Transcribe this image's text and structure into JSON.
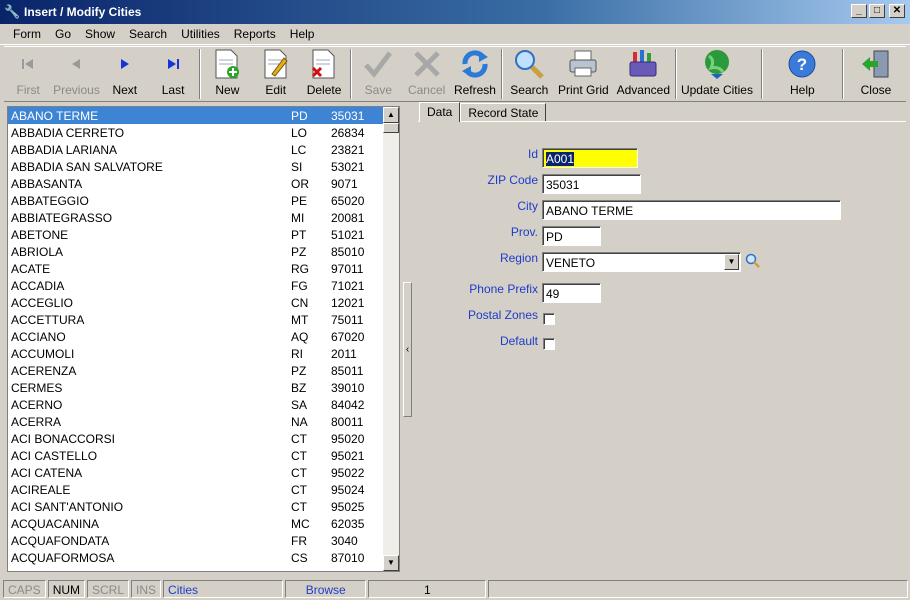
{
  "window": {
    "title": "Insert / Modify Cities"
  },
  "menu": [
    "Form",
    "Go",
    "Show",
    "Search",
    "Utilities",
    "Reports",
    "Help"
  ],
  "toolbar": {
    "first": "First",
    "previous": "Previous",
    "next": "Next",
    "last": "Last",
    "new": "New",
    "edit": "Edit",
    "delete": "Delete",
    "save": "Save",
    "cancel": "Cancel",
    "refresh": "Refresh",
    "search": "Search",
    "print_grid": "Print Grid",
    "advanced": "Advanced",
    "update_cities": "Update Cities",
    "help": "Help",
    "close": "Close"
  },
  "grid": {
    "rows": [
      [
        "ABANO TERME",
        "PD",
        "35031"
      ],
      [
        "ABBADIA CERRETO",
        "LO",
        "26834"
      ],
      [
        "ABBADIA LARIANA",
        "LC",
        "23821"
      ],
      [
        "ABBADIA SAN SALVATORE",
        "SI",
        "53021"
      ],
      [
        "ABBASANTA",
        "OR",
        "9071"
      ],
      [
        "ABBATEGGIO",
        "PE",
        "65020"
      ],
      [
        "ABBIATEGRASSO",
        "MI",
        "20081"
      ],
      [
        "ABETONE",
        "PT",
        "51021"
      ],
      [
        "ABRIOLA",
        "PZ",
        "85010"
      ],
      [
        "ACATE",
        "RG",
        "97011"
      ],
      [
        "ACCADIA",
        "FG",
        "71021"
      ],
      [
        "ACCEGLIO",
        "CN",
        "12021"
      ],
      [
        "ACCETTURA",
        "MT",
        "75011"
      ],
      [
        "ACCIANO",
        "AQ",
        "67020"
      ],
      [
        "ACCUMOLI",
        "RI",
        "2011"
      ],
      [
        "ACERENZA",
        "PZ",
        "85011"
      ],
      [
        "CERMES",
        "BZ",
        "39010"
      ],
      [
        "ACERNO",
        "SA",
        "84042"
      ],
      [
        "ACERRA",
        "NA",
        "80011"
      ],
      [
        "ACI BONACCORSI",
        "CT",
        "95020"
      ],
      [
        "ACI CASTELLO",
        "CT",
        "95021"
      ],
      [
        "ACI CATENA",
        "CT",
        "95022"
      ],
      [
        "ACIREALE",
        "CT",
        "95024"
      ],
      [
        "ACI SANT'ANTONIO",
        "CT",
        "95025"
      ],
      [
        "ACQUACANINA",
        "MC",
        "62035"
      ],
      [
        "ACQUAFONDATA",
        "FR",
        "3040"
      ],
      [
        "ACQUAFORMOSA",
        "CS",
        "87010"
      ]
    ]
  },
  "tabs": {
    "data": "Data",
    "record_state": "Record State"
  },
  "form": {
    "id_label": "Id",
    "id_value": "A001",
    "zip_label": "ZIP Code",
    "zip_value": "35031",
    "city_label": "City",
    "city_value": "ABANO TERME",
    "prov_label": "Prov.",
    "prov_value": "PD",
    "region_label": "Region",
    "region_value": "VENETO",
    "phone_label": "Phone Prefix",
    "phone_value": "49",
    "postal_label": "Postal Zones",
    "default_label": "Default"
  },
  "status": {
    "caps": "CAPS",
    "num": "NUM",
    "scrl": "SCRL",
    "ins": "INS",
    "table": "Cities",
    "mode": "Browse",
    "record": "1"
  }
}
